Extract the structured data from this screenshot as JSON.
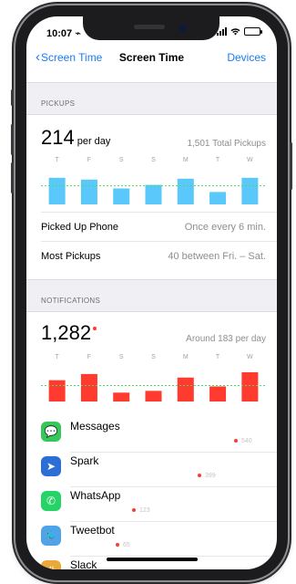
{
  "status": {
    "time": "10:07 ⌁"
  },
  "nav": {
    "back": "Screen Time",
    "title": "Screen Time",
    "right": "Devices"
  },
  "pickups": {
    "header": "PICKUPS",
    "value": "214",
    "unit": "per day",
    "total": "1,501 Total Pickups",
    "days": [
      "T",
      "F",
      "S",
      "S",
      "M",
      "T",
      "W"
    ],
    "bars": [
      30,
      28,
      18,
      22,
      29,
      14,
      30
    ],
    "bar_color": "#5ac8fa",
    "avg": 21,
    "rows": [
      {
        "label": "Picked Up Phone",
        "value": "Once every 6 min."
      },
      {
        "label": "Most Pickups",
        "value": "40 between Fri. – Sat."
      }
    ]
  },
  "notifications": {
    "header": "NOTIFICATIONS",
    "value": "1,282",
    "per_day": "Around 183 per day",
    "days": [
      "T",
      "F",
      "S",
      "S",
      "M",
      "T",
      "W"
    ],
    "bars": [
      24,
      31,
      10,
      12,
      27,
      17,
      33
    ],
    "bar_color": "#ff3b30",
    "avg": 18,
    "apps": [
      {
        "name": "Messages",
        "count": "540",
        "icon": "messages-icon",
        "color": "#34c759",
        "glyph": "💬"
      },
      {
        "name": "Spark",
        "count": "399",
        "icon": "spark-icon",
        "color": "#2b6fd6",
        "glyph": "➤"
      },
      {
        "name": "WhatsApp",
        "count": "123",
        "icon": "whatsapp-icon",
        "color": "#25d366",
        "glyph": "✆"
      },
      {
        "name": "Tweetbot",
        "count": "65",
        "icon": "tweetbot-icon",
        "color": "#4fa3e8",
        "glyph": "🐦"
      },
      {
        "name": "Slack",
        "count": "",
        "icon": "slack-icon",
        "color": "#e8a93a",
        "glyph": "#"
      }
    ]
  }
}
